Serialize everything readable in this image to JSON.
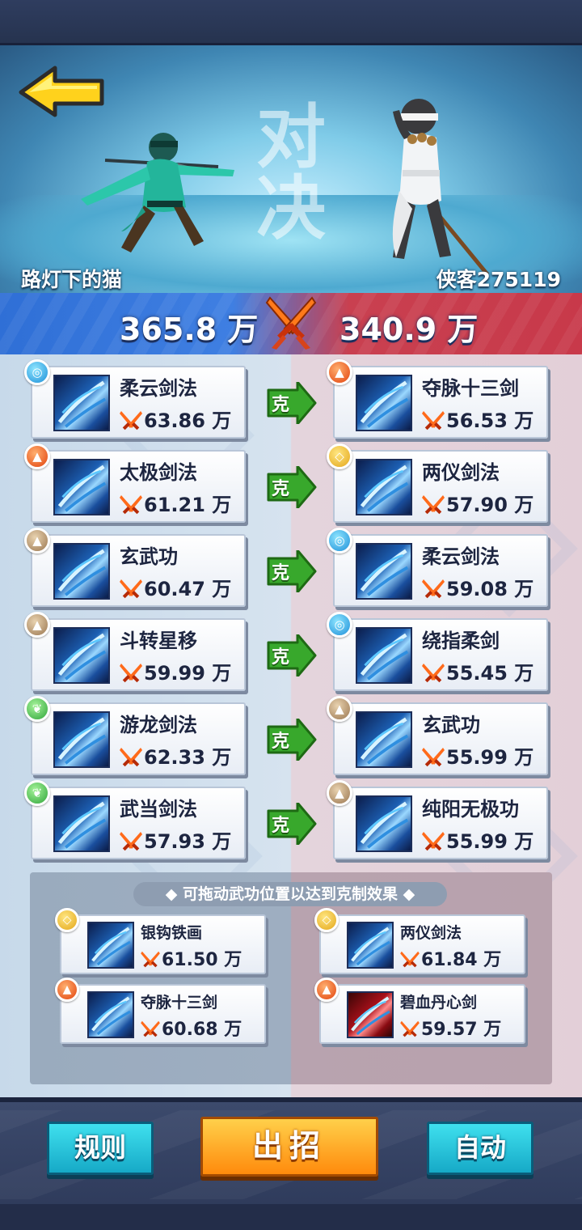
{
  "header": {
    "vs_title": "对决",
    "player_left": "路灯下的猫",
    "player_right": "侠客275119",
    "power_left": "365.8 万",
    "power_right": "340.9 万"
  },
  "counter_label": "克",
  "matchups": [
    {
      "left": {
        "element": "water",
        "name": "柔云剑法",
        "power": "63.86 万"
      },
      "right": {
        "element": "fire",
        "name": "夺脉十三剑",
        "power": "56.53 万"
      }
    },
    {
      "left": {
        "element": "fire",
        "name": "太极剑法",
        "power": "61.21 万"
      },
      "right": {
        "element": "metal",
        "name": "两仪剑法",
        "power": "57.90 万"
      }
    },
    {
      "left": {
        "element": "earth",
        "name": "玄武功",
        "power": "60.47 万"
      },
      "right": {
        "element": "water",
        "name": "柔云剑法",
        "power": "59.08 万"
      }
    },
    {
      "left": {
        "element": "earth",
        "name": "斗转星移",
        "power": "59.99 万"
      },
      "right": {
        "element": "water",
        "name": "绕指柔剑",
        "power": "55.45 万"
      }
    },
    {
      "left": {
        "element": "wood",
        "name": "游龙剑法",
        "power": "62.33 万"
      },
      "right": {
        "element": "earth",
        "name": "玄武功",
        "power": "55.99 万"
      }
    },
    {
      "left": {
        "element": "wood",
        "name": "武当剑法",
        "power": "57.93 万"
      },
      "right": {
        "element": "earth",
        "name": "纯阳无极功",
        "power": "55.99 万"
      }
    }
  ],
  "reserve": {
    "hint": "◆ 可拖动武功位置以达到克制效果 ◆",
    "items": [
      {
        "element": "metal",
        "name": "银钩铁画",
        "power": "61.50 万"
      },
      {
        "element": "metal",
        "name": "两仪剑法",
        "power": "61.84 万"
      },
      {
        "element": "fire",
        "name": "夺脉十三剑",
        "power": "60.68 万"
      },
      {
        "element": "fire",
        "name": "碧血丹心剑",
        "power": "59.57 万"
      }
    ]
  },
  "buttons": {
    "rules": "规则",
    "attack": "出招",
    "auto": "自动"
  },
  "colors": {
    "player_side": "#2f6fd6",
    "enemy_side": "#c8394a",
    "counter_arrow": "#2f9a26",
    "attack_button": "#ff9a16",
    "side_button": "#22b8d4"
  }
}
